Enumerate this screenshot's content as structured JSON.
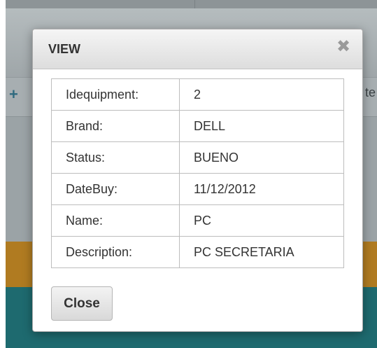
{
  "background": {
    "left_symbol": "+",
    "right_partial_text": "te"
  },
  "modal": {
    "title": "VIEW",
    "close_icon": "close-x-icon",
    "close_glyph": "✖",
    "rows": [
      {
        "label": "Idequipment:",
        "value": "2"
      },
      {
        "label": "Brand:",
        "value": "DELL"
      },
      {
        "label": "Status:",
        "value": "BUENO"
      },
      {
        "label": "DateBuy:",
        "value": "11/12/2012"
      },
      {
        "label": "Name:",
        "value": "PC"
      },
      {
        "label": "Description:",
        "value": "PC SECRETARIA"
      }
    ],
    "close_button_label": "Close"
  },
  "colors": {
    "overlay": "#9ba3a6",
    "orange_band": "#b07b21",
    "teal_band": "#1e6a6f",
    "accent_plus": "#2f6a7f"
  }
}
